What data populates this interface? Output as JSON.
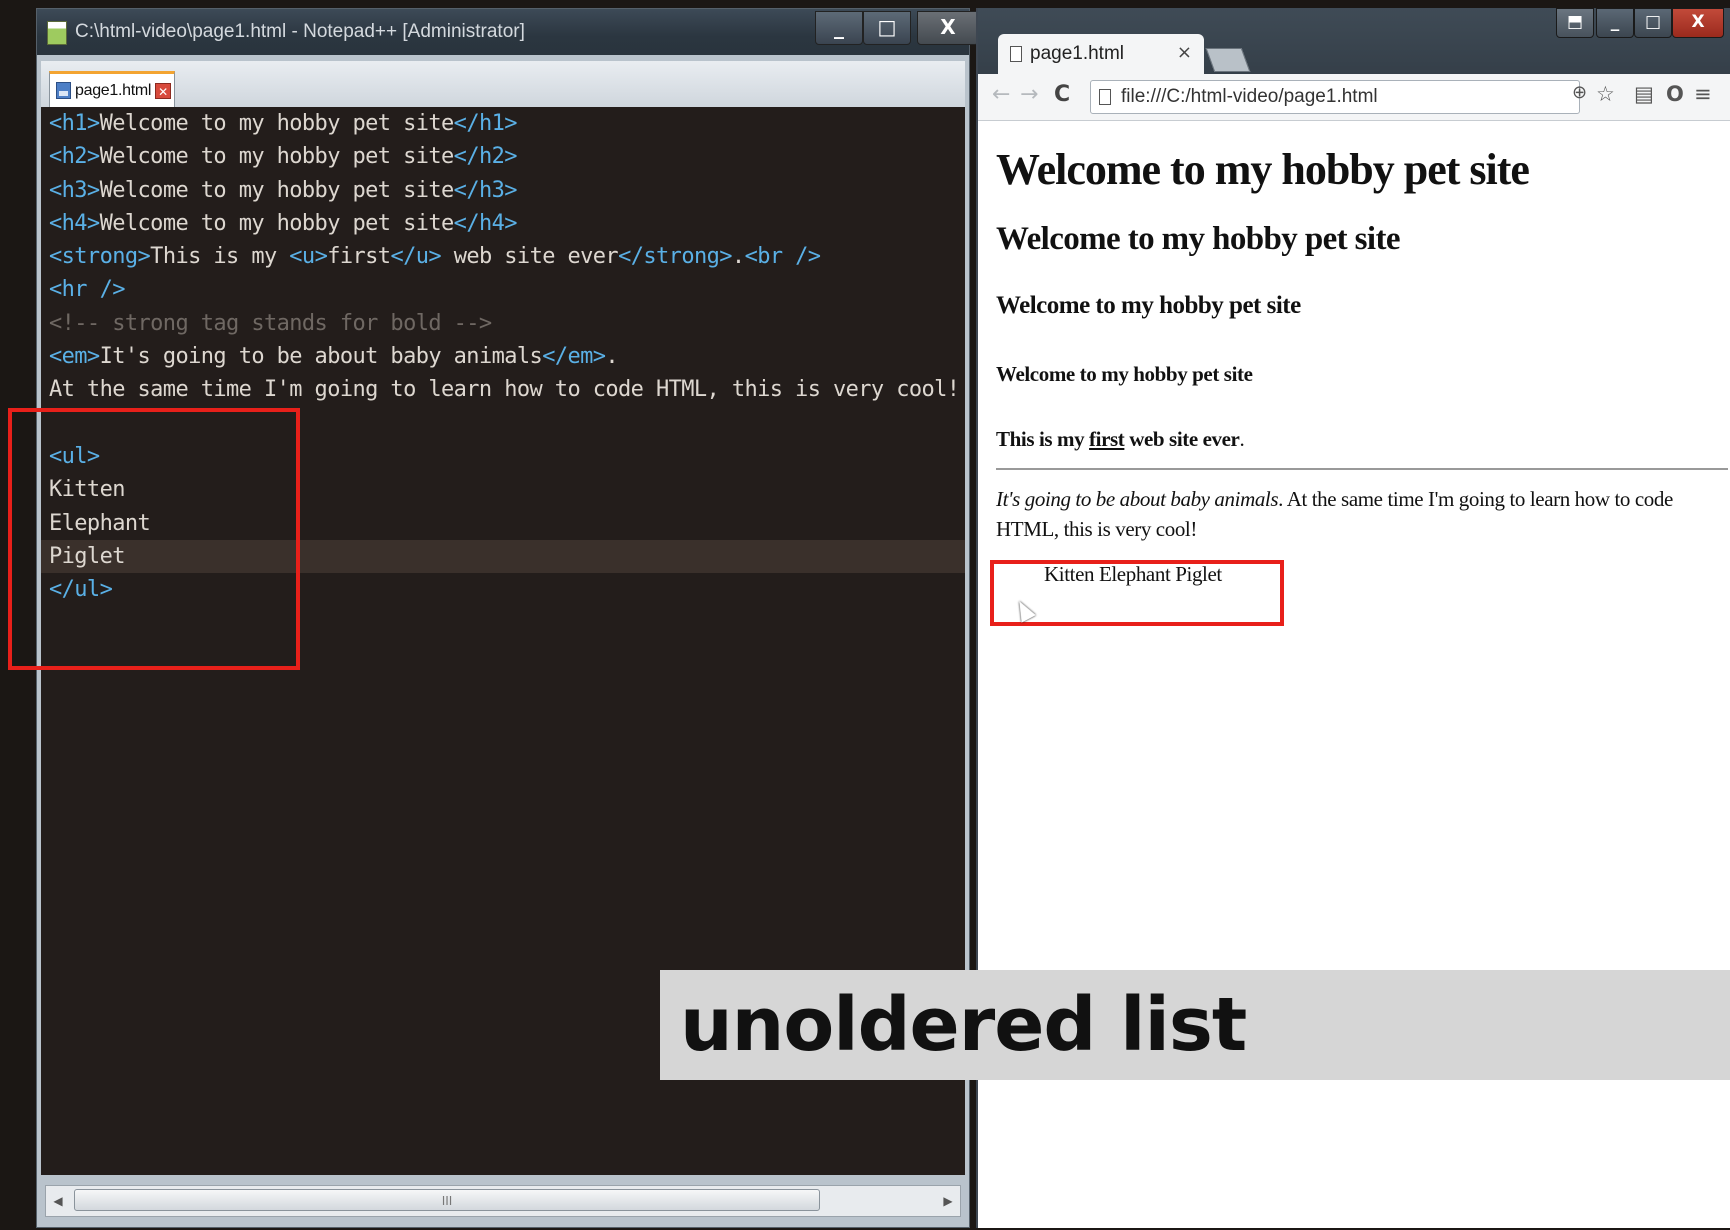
{
  "notepad": {
    "title": "C:\\html-video\\page1.html - Notepad++ [Administrator]",
    "tab_label": "page1.html",
    "window_buttons": {
      "minimize": "_",
      "maximize": "□",
      "close": "X"
    },
    "code_lines": [
      {
        "parts": [
          {
            "t": "tag",
            "v": "<h1>"
          },
          {
            "t": "txt",
            "v": "Welcome to my hobby pet site"
          },
          {
            "t": "tag",
            "v": "</h1>"
          }
        ]
      },
      {
        "parts": [
          {
            "t": "tag",
            "v": "<h2>"
          },
          {
            "t": "txt",
            "v": "Welcome to my hobby pet site"
          },
          {
            "t": "tag",
            "v": "</h2>"
          }
        ]
      },
      {
        "parts": [
          {
            "t": "tag",
            "v": "<h3>"
          },
          {
            "t": "txt",
            "v": "Welcome to my hobby pet site"
          },
          {
            "t": "tag",
            "v": "</h3>"
          }
        ]
      },
      {
        "parts": [
          {
            "t": "tag",
            "v": "<h4>"
          },
          {
            "t": "txt",
            "v": "Welcome to my hobby pet site"
          },
          {
            "t": "tag",
            "v": "</h4>"
          }
        ]
      },
      {
        "parts": [
          {
            "t": "tag",
            "v": "<strong>"
          },
          {
            "t": "txt",
            "v": "This is my "
          },
          {
            "t": "tag",
            "v": "<u>"
          },
          {
            "t": "txt",
            "v": "first"
          },
          {
            "t": "tag",
            "v": "</u>"
          },
          {
            "t": "txt",
            "v": " web site ever"
          },
          {
            "t": "tag",
            "v": "</strong>"
          },
          {
            "t": "txt",
            "v": "."
          },
          {
            "t": "tag",
            "v": "<br />"
          }
        ]
      },
      {
        "parts": [
          {
            "t": "tag",
            "v": "<hr />"
          }
        ]
      },
      {
        "parts": [
          {
            "t": "cmt",
            "v": "<!-- strong tag stands for bold -->"
          }
        ]
      },
      {
        "parts": [
          {
            "t": "tag",
            "v": "<em>"
          },
          {
            "t": "txt",
            "v": "It's going to be about baby animals"
          },
          {
            "t": "tag",
            "v": "</em>"
          },
          {
            "t": "txt",
            "v": "."
          }
        ]
      },
      {
        "parts": [
          {
            "t": "txt",
            "v": "At the same time I'm going to learn how to code HTML, this is very cool!"
          }
        ]
      },
      {
        "parts": []
      },
      {
        "parts": [
          {
            "t": "tag",
            "v": "<ul>"
          }
        ]
      },
      {
        "parts": [
          {
            "t": "txt",
            "v": "Kitten"
          }
        ]
      },
      {
        "parts": [
          {
            "t": "txt",
            "v": "Elephant"
          }
        ]
      },
      {
        "parts": [
          {
            "t": "txt",
            "v": "Piglet"
          }
        ],
        "current": true
      },
      {
        "parts": [
          {
            "t": "tag",
            "v": "</ul>"
          }
        ]
      }
    ],
    "scroll_thumb_label": "III"
  },
  "chrome": {
    "tab_title": "page1.html",
    "tab_close": "×",
    "url": "file:///C:/html-video/page1.html",
    "nav": {
      "back": "←",
      "forward": "→",
      "reload": "C"
    },
    "page": {
      "h1": "Welcome to my hobby pet site",
      "h2": "Welcome to my hobby pet site",
      "h3": "Welcome to my hobby pet site",
      "h4": "Welcome to my hobby pet site",
      "strong_pre": "This is my ",
      "strong_u": "first",
      "strong_post": " web site ever",
      "strong_end": ".",
      "em_text": "It's going to be about baby animals",
      "para_rest": ". At the same time I'm going to learn how to code HTML, this is very cool!",
      "list_inline": "Kitten Elephant Piglet"
    }
  },
  "caption": "unoldered list",
  "colors": {
    "highlight": "#e8201a",
    "tag": "#5ab0e6",
    "editor_bg": "#231d1b"
  }
}
